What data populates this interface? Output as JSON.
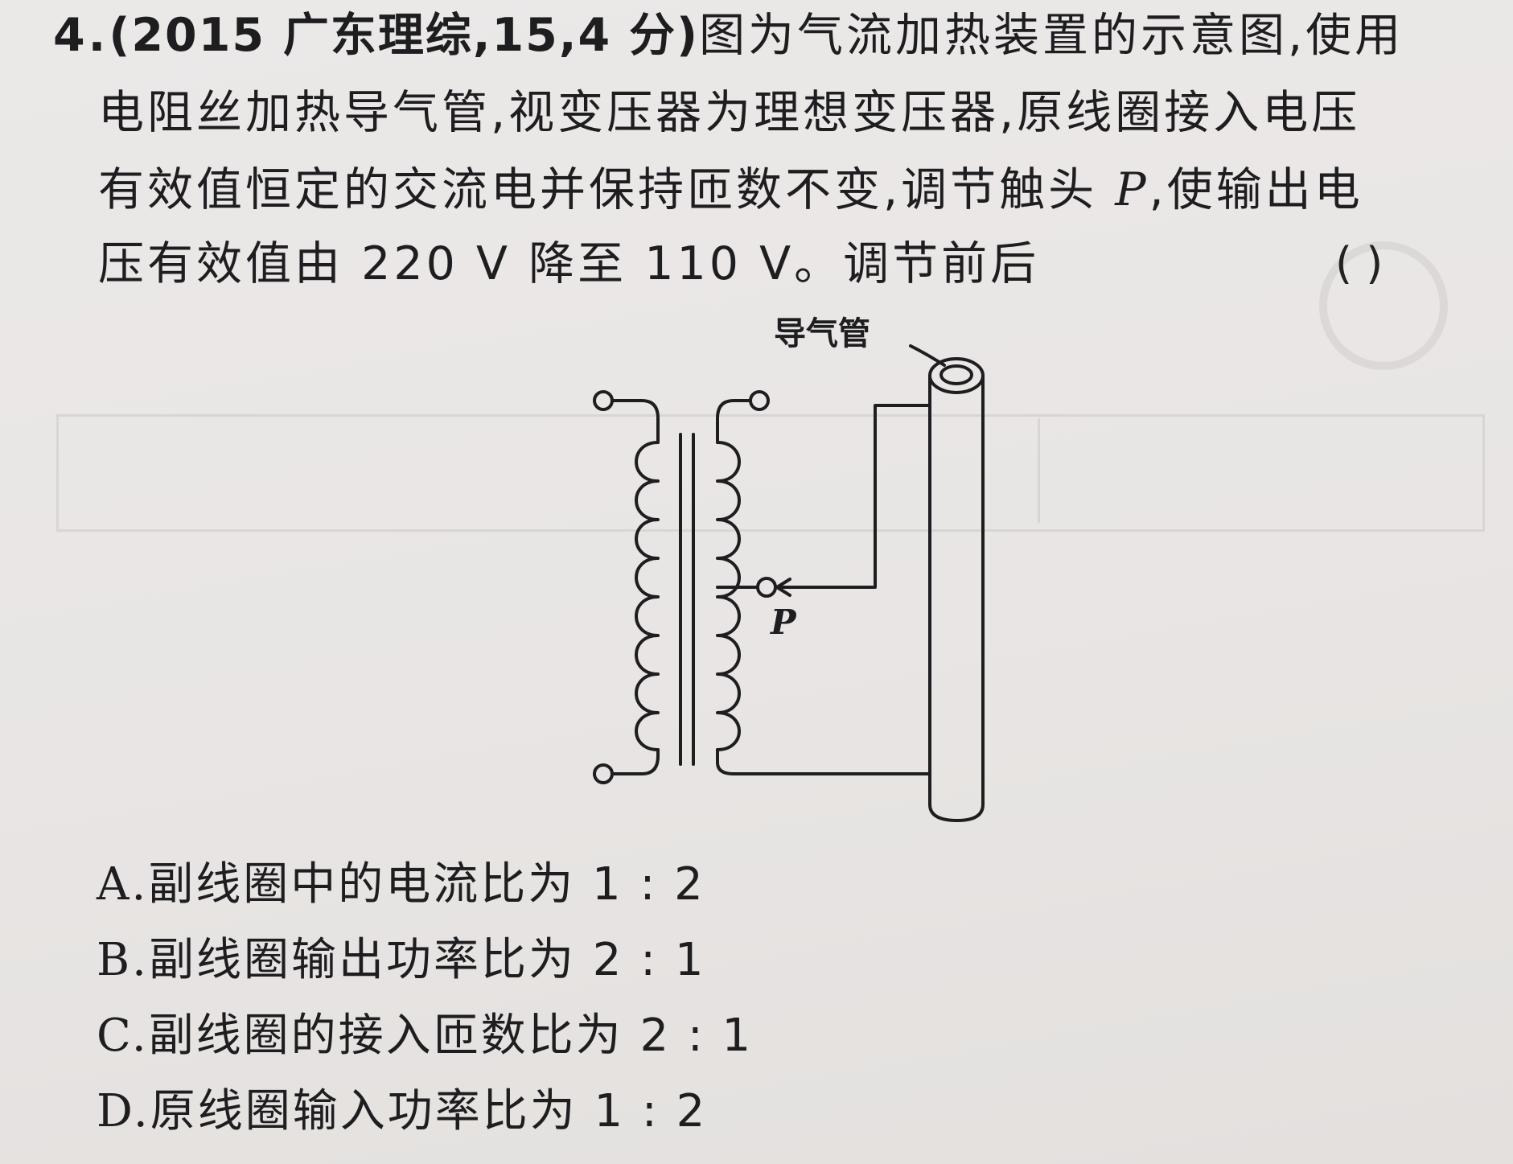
{
  "question": {
    "number": "4.",
    "source": "(2015 广东理综,15,4 分)",
    "lines": [
      "图为气流加热装置的示意图,使用",
      "电阻丝加热导气管,视变压器为理想变压器,原线圈接入电压",
      "有效值恒定的交流电并保持匝数不变,调节触头",
      ",使输出电",
      "压有效值由 220 V 降至 110 V。调节前后"
    ],
    "contact_symbol": "P",
    "answer_brackets": "(        )"
  },
  "diagram": {
    "tube_label": "导气管",
    "contact_label": "P"
  },
  "options": [
    {
      "letter": "A.",
      "text": "副线圈中的电流比为 1 : 2"
    },
    {
      "letter": "B.",
      "text": "副线圈输出功率比为 2 : 1"
    },
    {
      "letter": "C.",
      "text": "副线圈的接入匝数比为 2 : 1"
    },
    {
      "letter": "D.",
      "text": "原线圈输入功率比为 1 : 2"
    }
  ],
  "colors": {
    "ink": "#1e1d1f",
    "paper": "#eae7e6"
  }
}
